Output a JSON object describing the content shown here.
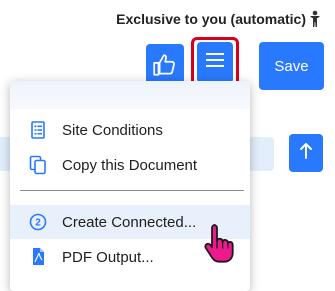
{
  "header": {
    "exclusive_label": "Exclusive to you (automatic)"
  },
  "toolbar": {
    "like_icon": "thumbs-up-icon",
    "menu_icon": "hamburger-menu-icon",
    "save_label": "Save",
    "accent_color": "#2979ff",
    "highlight_color": "#d6001c"
  },
  "dropdown": {
    "items": [
      {
        "label": "Site Conditions",
        "icon": "document-list-icon"
      },
      {
        "label": "Copy this Document",
        "icon": "copy-icon"
      },
      {
        "label": "Create Connected...",
        "icon": "numbered-circle-icon",
        "icon_text": "2",
        "hovered": true
      },
      {
        "label": "PDF Output...",
        "icon": "pdf-file-icon"
      }
    ]
  },
  "background": {
    "scroll_up_icon": "arrow-up-icon"
  },
  "cursor": {
    "icon": "hand-pointer-cursor-icon",
    "color": "#e8208a"
  }
}
